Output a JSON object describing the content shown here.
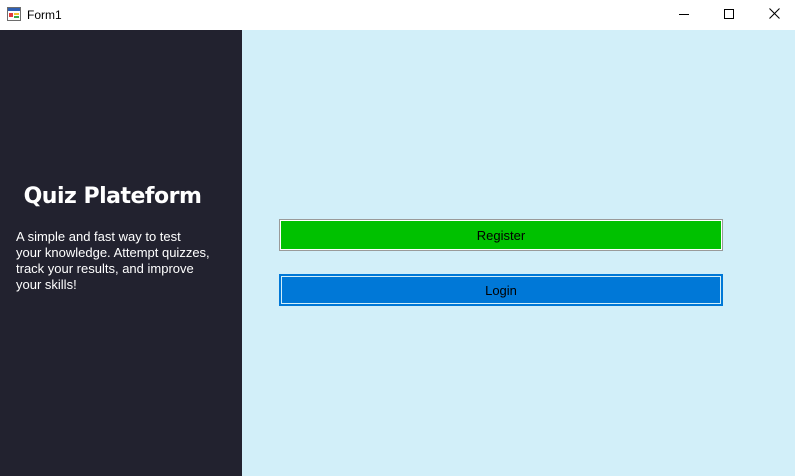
{
  "window": {
    "title": "Form1",
    "icon": "winforms-app-icon",
    "controls": {
      "minimize_icon": "minimize-icon",
      "maximize_icon": "maximize-icon",
      "close_icon": "close-icon"
    }
  },
  "sidebar": {
    "title": "Quiz Plateform",
    "description": "A simple and fast way to test\n your knowledge. Attempt quizzes,\n  track your results, and improve\n  your skills!",
    "background": "#22222f"
  },
  "main": {
    "background": "#d2eff9",
    "register_label": "Register",
    "register_color": "#00c100",
    "login_label": "Login",
    "login_color": "#0078d7"
  }
}
